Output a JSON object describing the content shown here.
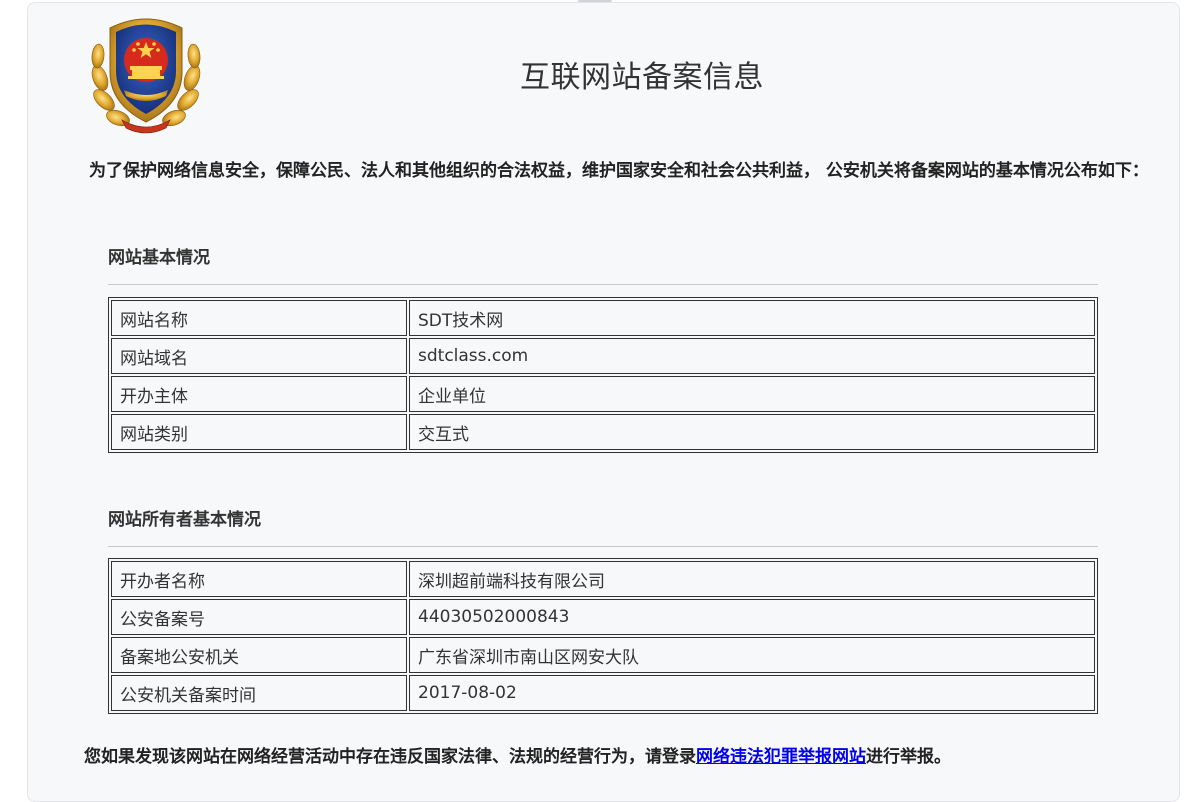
{
  "header": {
    "title": "互联网站备案信息"
  },
  "intro": {
    "text": "为了保护网络信息安全，保障公民、法人和其他组织的合法权益，维护国家安全和社会公共利益， 公安机关将备案网站的基本情况公布如下："
  },
  "site_section": {
    "title": "网站基本情况",
    "rows": [
      {
        "label": "网站名称",
        "value": "SDT技术网"
      },
      {
        "label": "网站域名",
        "value": "sdtclass.com"
      },
      {
        "label": "开办主体",
        "value": "企业单位"
      },
      {
        "label": "网站类别",
        "value": "交互式"
      }
    ]
  },
  "owner_section": {
    "title": "网站所有者基本情况",
    "rows": [
      {
        "label": "开办者名称",
        "value": "深圳超前端科技有限公司"
      },
      {
        "label": "公安备案号",
        "value": "44030502000843"
      },
      {
        "label": "备案地公安机关",
        "value": "广东省深圳市南山区网安大队"
      },
      {
        "label": "公安机关备案时间",
        "value": "2017-08-02"
      }
    ]
  },
  "footer": {
    "prefix": "您如果发现该网站在网络经营活动中存在违反国家法律、法规的经营行为，请登录",
    "link_text": "网络违法犯罪举报网站",
    "suffix": "进行举报。"
  },
  "colors": {
    "link": "#0000ee",
    "card_background": "#f7f8fa",
    "emblem_blue": "#1f3f9a",
    "emblem_red": "#d62a1e",
    "emblem_gold": "#e0a82e"
  },
  "icons": {
    "emblem": "police-emblem-icon"
  }
}
